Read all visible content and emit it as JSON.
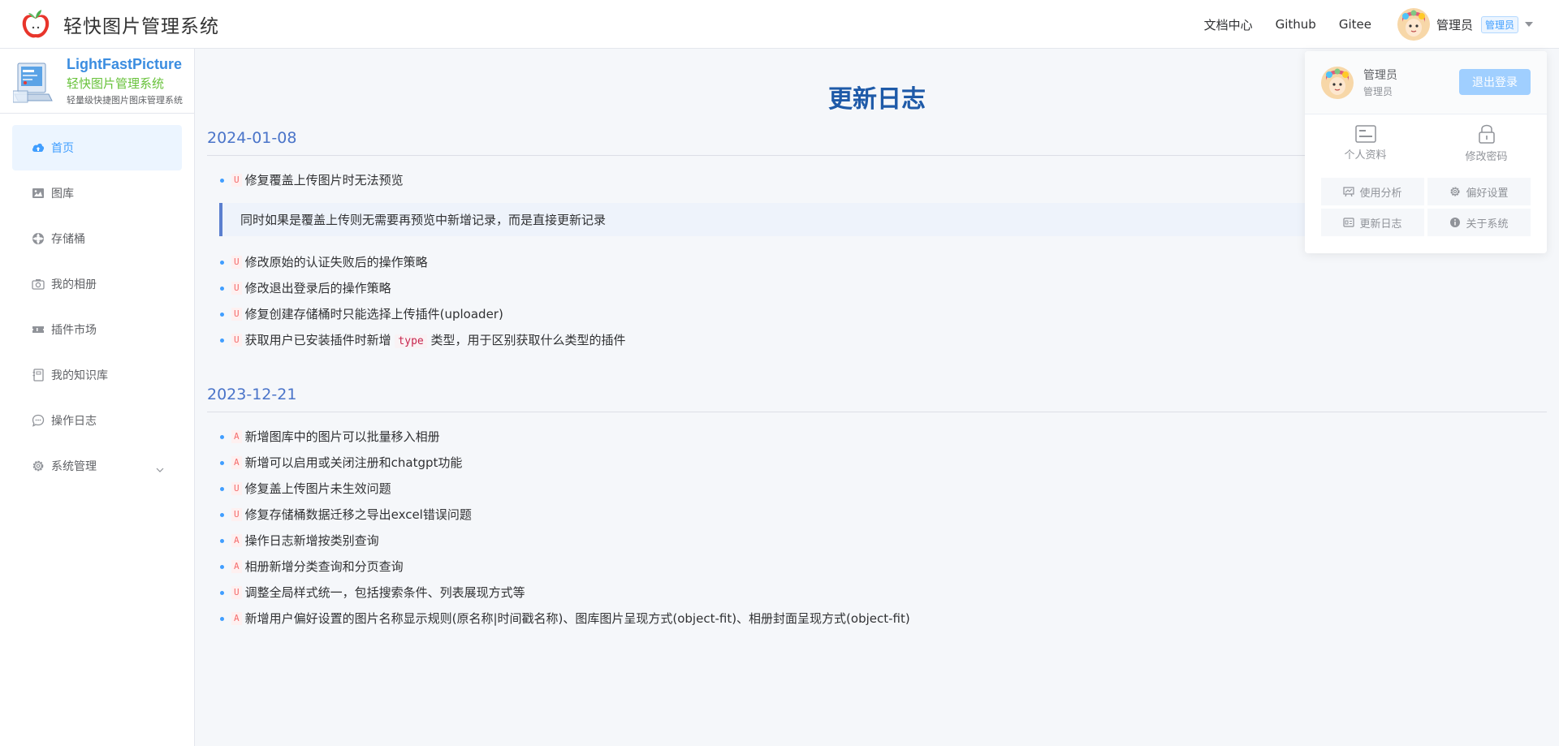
{
  "header": {
    "title": "轻快图片管理系统",
    "nav": [
      "文档中心",
      "Github",
      "Gitee"
    ],
    "user_name": "管理员",
    "role_tag": "管理员"
  },
  "sidebar": {
    "brand_title": "LightFastPicture",
    "brand_sub": "轻快图片管理系统",
    "brand_desc": "轻量级快捷图片图床管理系统",
    "items": [
      {
        "label": "首页",
        "icon": "cloud-upload-icon",
        "active": true
      },
      {
        "label": "图库",
        "icon": "picture-icon"
      },
      {
        "label": "存储桶",
        "icon": "bucket-icon"
      },
      {
        "label": "我的相册",
        "icon": "camera-icon"
      },
      {
        "label": "插件市场",
        "icon": "ticket-icon"
      },
      {
        "label": "我的知识库",
        "icon": "notebook-icon"
      },
      {
        "label": "操作日志",
        "icon": "chat-icon"
      },
      {
        "label": "系统管理",
        "icon": "gear-icon",
        "has_submenu": true
      }
    ]
  },
  "main": {
    "page_title": "更新日志",
    "sections": [
      {
        "date": "2024-01-08",
        "first_item": {
          "tag": "U",
          "text": "修复覆盖上传图片时无法预览"
        },
        "quote": "同时如果是覆盖上传则无需要再预览中新增记录，而是直接更新记录",
        "items": [
          {
            "tag": "U",
            "text": "修改原始的认证失败后的操作策略"
          },
          {
            "tag": "U",
            "text": "修改退出登录后的操作策略"
          },
          {
            "tag": "U",
            "text": "修复创建存储桶时只能选择上传插件(uploader)"
          }
        ],
        "last_item": {
          "tag": "U",
          "text_before": "获取用户已安装插件时新增",
          "code": "type",
          "text_after": "类型，用于区别获取什么类型的插件"
        }
      },
      {
        "date": "2023-12-21",
        "items": [
          {
            "tag": "A",
            "text": "新增图库中的图片可以批量移入相册"
          },
          {
            "tag": "A",
            "text": "新增可以启用或关闭注册和chatgpt功能"
          },
          {
            "tag": "U",
            "text": "修复盖上传图片未生效问题"
          },
          {
            "tag": "U",
            "text": "修复存储桶数据迁移之导出excel错误问题"
          },
          {
            "tag": "A",
            "text": "操作日志新增按类别查询"
          },
          {
            "tag": "A",
            "text": "相册新增分类查询和分页查询"
          },
          {
            "tag": "U",
            "text": "调整全局样式统一，包括搜索条件、列表展现方式等"
          },
          {
            "tag": "A",
            "text": "新增用户偏好设置的图片名称显示规则(原名称|时间戳名称)、图库图片呈现方式(object-fit)、相册封面呈现方式(object-fit)"
          }
        ]
      }
    ]
  },
  "dropdown": {
    "user_name": "管理员",
    "user_role": "管理员",
    "logout_label": "退出登录",
    "quick": [
      {
        "label": "个人资料",
        "icon": "id-card-icon"
      },
      {
        "label": "修改密码",
        "icon": "lock-icon"
      }
    ],
    "grid": [
      {
        "label": "使用分析",
        "icon": "chart-board-icon"
      },
      {
        "label": "偏好设置",
        "icon": "gear-icon"
      },
      {
        "label": "更新日志",
        "icon": "log-icon"
      },
      {
        "label": "关于系统",
        "icon": "info-icon"
      }
    ]
  },
  "colors": {
    "accent": "#409eff",
    "title_blue": "#1e5aa8",
    "date_blue": "#4a74c9",
    "tag_red": "#f56c6c",
    "logout_bg": "#a0cfff"
  }
}
